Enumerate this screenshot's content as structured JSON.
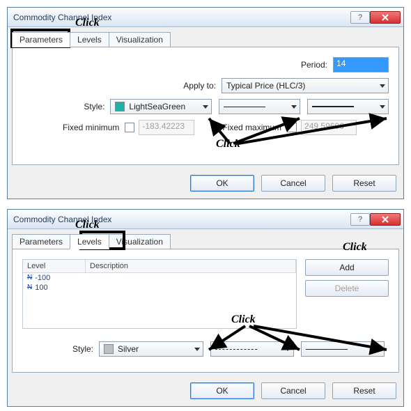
{
  "dialog1": {
    "title": "Commodity Channel Index",
    "tabs": [
      "Parameters",
      "Levels",
      "Visualization"
    ],
    "active_tab": 0,
    "fields": {
      "period_label": "Period:",
      "period_value": "14",
      "apply_label": "Apply to:",
      "apply_value": "Typical Price (HLC/3)",
      "style_label": "Style:",
      "style_color_name": "LightSeaGreen",
      "style_color_hex": "#20b2aa",
      "fixed_min_label": "Fixed minimum",
      "fixed_min_value": "-183.42223",
      "fixed_max_label": "Fixed maximum",
      "fixed_max_value": "249.59606"
    },
    "buttons": {
      "ok": "OK",
      "cancel": "Cancel",
      "reset": "Reset"
    }
  },
  "dialog2": {
    "title": "Commodity Channel Index",
    "tabs": [
      "Parameters",
      "Levels",
      "Visualization"
    ],
    "active_tab": 1,
    "levels": {
      "col_level": "Level",
      "col_desc": "Description",
      "rows": [
        "-100",
        "100"
      ]
    },
    "side_buttons": {
      "add": "Add",
      "delete": "Delete"
    },
    "fields": {
      "style_label": "Style:",
      "style_color_name": "Silver",
      "style_color_hex": "#c0c0c0"
    },
    "buttons": {
      "ok": "OK",
      "cancel": "Cancel",
      "reset": "Reset"
    }
  },
  "annotations": {
    "click": "Click"
  }
}
